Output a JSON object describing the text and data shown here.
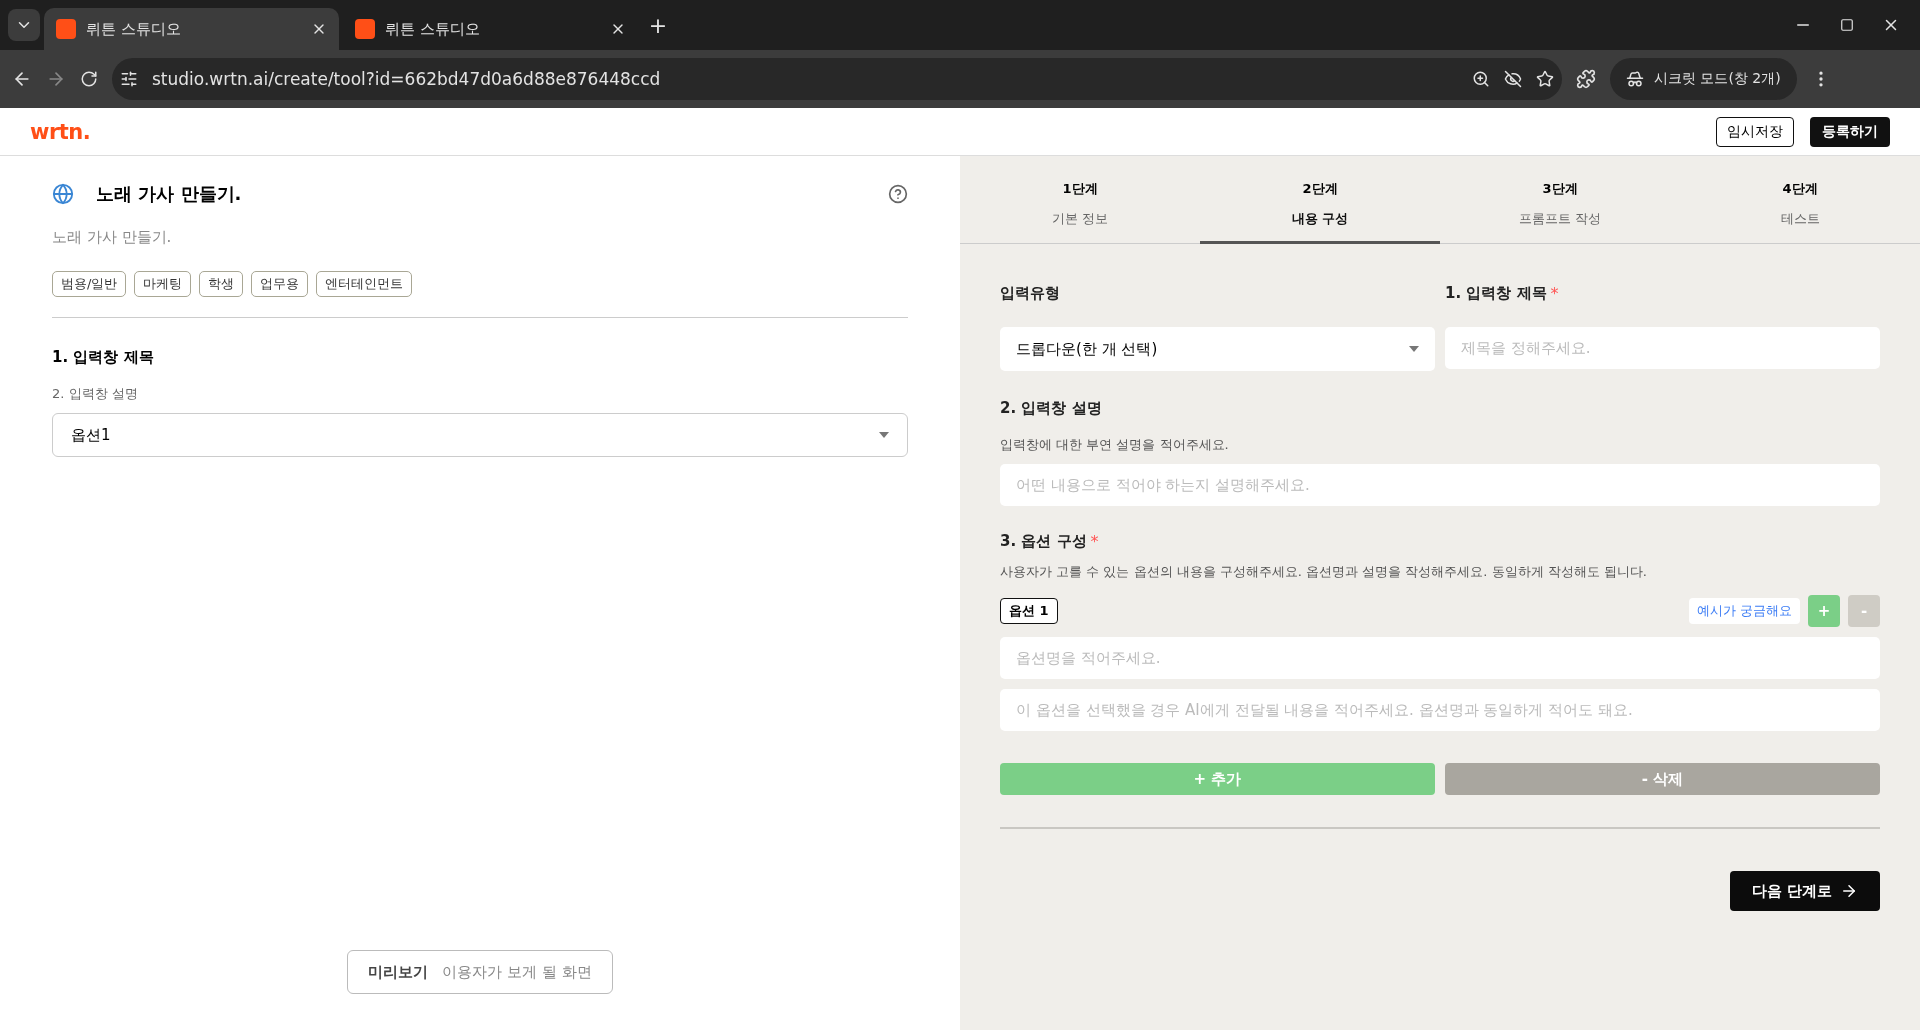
{
  "browser": {
    "tabs": [
      {
        "title": "뤼튼 스튜디오",
        "selected": true
      },
      {
        "title": "뤼튼 스튜디오",
        "selected": false
      }
    ],
    "new_tab": "+",
    "url": "studio.wrtn.ai/create/tool?id=662bd47d0a6d88e876448ccd",
    "profile": "시크릿 모드(창 2개)"
  },
  "header": {
    "logo": "wrtn.",
    "save_button": "임시저장",
    "register_button": "등록하기"
  },
  "preview": {
    "title": "노래 가사 만들기.",
    "description": "노래 가사 만들기.",
    "tags": [
      "범용/일반",
      "마케팅",
      "학생",
      "업무용",
      "엔터테인먼트"
    ],
    "field_title": "1. 입력창 제목",
    "field_description": "2. 입력창 설명",
    "select_value": "옵션1",
    "preview_button": {
      "label": "미리보기",
      "hint": "이용자가 보게 될 화면"
    }
  },
  "steps": [
    {
      "step": "1단계",
      "label": "기본 정보",
      "selected": false
    },
    {
      "step": "2단계",
      "label": "내용 구성",
      "selected": true
    },
    {
      "step": "3단계",
      "label": "프롬프트 작성",
      "selected": false
    },
    {
      "step": "4단계",
      "label": "테스트",
      "selected": false
    }
  ],
  "form": {
    "input_type_label": "입력유형",
    "input_type_value": "드롭다운(한 개 선택)",
    "title_label": "1. 입력창 제목",
    "title_required_mark": "*",
    "title_placeholder": "제목을 정해주세요.",
    "description_label": "2. 입력창 설명",
    "description_help": "입력창에 대한 부연 설명을 적어주세요.",
    "description_placeholder": "어떤 내용으로 적어야 하는지 설명해주세요.",
    "options_label": "3. 옵션 구성",
    "options_required_mark": "*",
    "options_help": "사용자가 고를 수 있는 옵션의 내용을 구성해주세요. 옵션명과 설명을 작성해주세요. 동일하게 작성해도 됩니다.",
    "options": [
      {
        "tag": "옵션 1",
        "name_placeholder": "옵션명을 적어주세요.",
        "content_placeholder": "이 옵션을 선택했을 경우 AI에게 전달될 내용을 적어주세요. 옵션명과 동일하게 적어도 돼요."
      }
    ],
    "example_link": "예시가 궁금해요",
    "plus_small": "+",
    "minus_small": "-",
    "add_button": "+ 추가",
    "delete_button": "- 삭제",
    "next_button": "다음 단계로"
  }
}
